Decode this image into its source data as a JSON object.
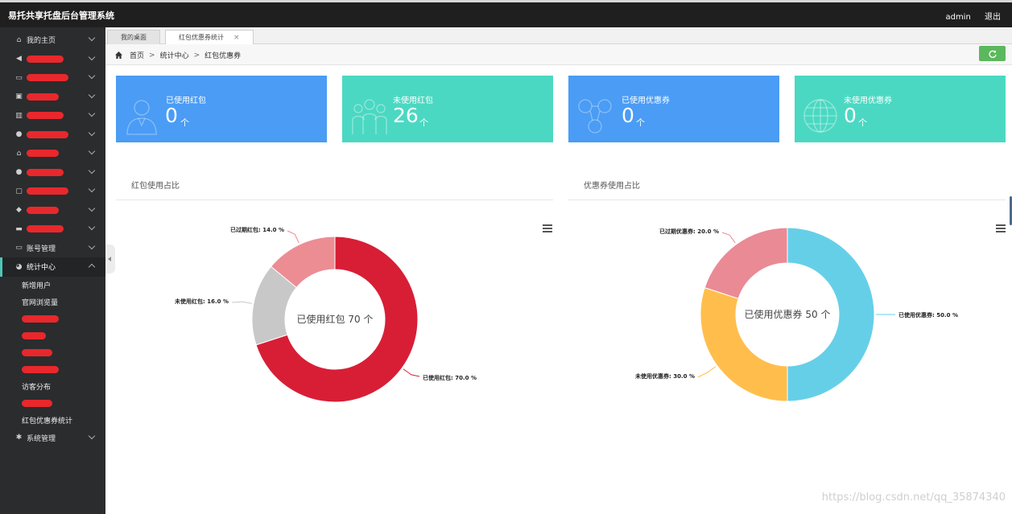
{
  "header": {
    "title": "易托共享托盘后台管理系统",
    "user": "admin",
    "logout": "退出"
  },
  "sidebar": {
    "items": [
      {
        "icon": "home-icon",
        "label": "我的主页",
        "glyph": "⌂"
      },
      {
        "icon": "megaphone-icon",
        "label": "",
        "glyph": "◀"
      },
      {
        "icon": "keyboard-icon",
        "label": "",
        "glyph": "▭"
      },
      {
        "icon": "clipboard-icon",
        "label": "",
        "glyph": "▣"
      },
      {
        "icon": "bar-chart-icon",
        "label": "",
        "glyph": "▥"
      },
      {
        "icon": "coin-icon",
        "label": "",
        "glyph": "●"
      },
      {
        "icon": "bank-icon",
        "label": "",
        "glyph": "⌂"
      },
      {
        "icon": "user-icon",
        "label": "",
        "glyph": "●"
      },
      {
        "icon": "monitor-icon",
        "label": "",
        "glyph": "▢"
      },
      {
        "icon": "cube-icon",
        "label": "",
        "glyph": "◆"
      },
      {
        "icon": "truck-icon",
        "label": "",
        "glyph": "▬"
      },
      {
        "icon": "card-icon",
        "label": "账号管理",
        "glyph": "▭"
      }
    ],
    "active": {
      "icon": "pie-chart-icon",
      "label": "统计中心"
    },
    "subitems": [
      "新增用户",
      "官网浏览量",
      "",
      "",
      "",
      "",
      "访客分布",
      "",
      "红包优惠券统计"
    ],
    "footer": {
      "icon": "gear-icon",
      "label": "系统管理"
    }
  },
  "tabs": [
    {
      "label": "我的桌面"
    },
    {
      "label": "红包优惠券统计",
      "close": "×"
    }
  ],
  "breadcrumb": [
    "首页",
    "统计中心",
    "红包优惠券"
  ],
  "breadcrumb_sep": ">",
  "cards": [
    {
      "label": "已使用红包",
      "value": "0",
      "unit": "个",
      "icon": "person-icon",
      "color": "#4a9cf5"
    },
    {
      "label": "未使用红包",
      "value": "26",
      "unit": "个",
      "icon": "group-icon",
      "color": "#4bd8c2"
    },
    {
      "label": "已使用优惠券",
      "value": "0",
      "unit": "个",
      "icon": "network-icon",
      "color": "#4a9cf5"
    },
    {
      "label": "未使用优惠券",
      "value": "0",
      "unit": "个",
      "icon": "globe-icon",
      "color": "#4bd8c2"
    }
  ],
  "panels": [
    {
      "title": "红包使用占比"
    },
    {
      "title": "优惠券使用占比"
    }
  ],
  "chart_data": [
    {
      "type": "pie",
      "title": "",
      "center_label": "已使用红包 70 个",
      "slices": [
        {
          "name": "已使用红包",
          "value": 70.0,
          "label": "已使用红包: 70.0 %",
          "color": "#d81e35"
        },
        {
          "name": "未使用红包",
          "value": 16.0,
          "label": "未使用红包: 16.0 %",
          "color": "#c8c8c8"
        },
        {
          "name": "已过期红包",
          "value": 14.0,
          "label": "已过期红包: 14.0 %",
          "color": "#ec8d94"
        }
      ]
    },
    {
      "type": "pie",
      "title": "",
      "center_label": "已使用优惠券 50 个",
      "slices": [
        {
          "name": "已使用优惠券",
          "value": 50.0,
          "label": "已使用优惠券: 50.0 %",
          "color": "#66cfe8"
        },
        {
          "name": "未使用优惠券",
          "value": 30.0,
          "label": "未使用优惠券: 30.0 %",
          "color": "#ffbe4c"
        },
        {
          "name": "已过期优惠券",
          "value": 20.0,
          "label": "已过期优惠券: 20.0 %",
          "color": "#ea8a95"
        }
      ]
    }
  ],
  "watermark": "https://blog.csdn.net/qq_35874340"
}
